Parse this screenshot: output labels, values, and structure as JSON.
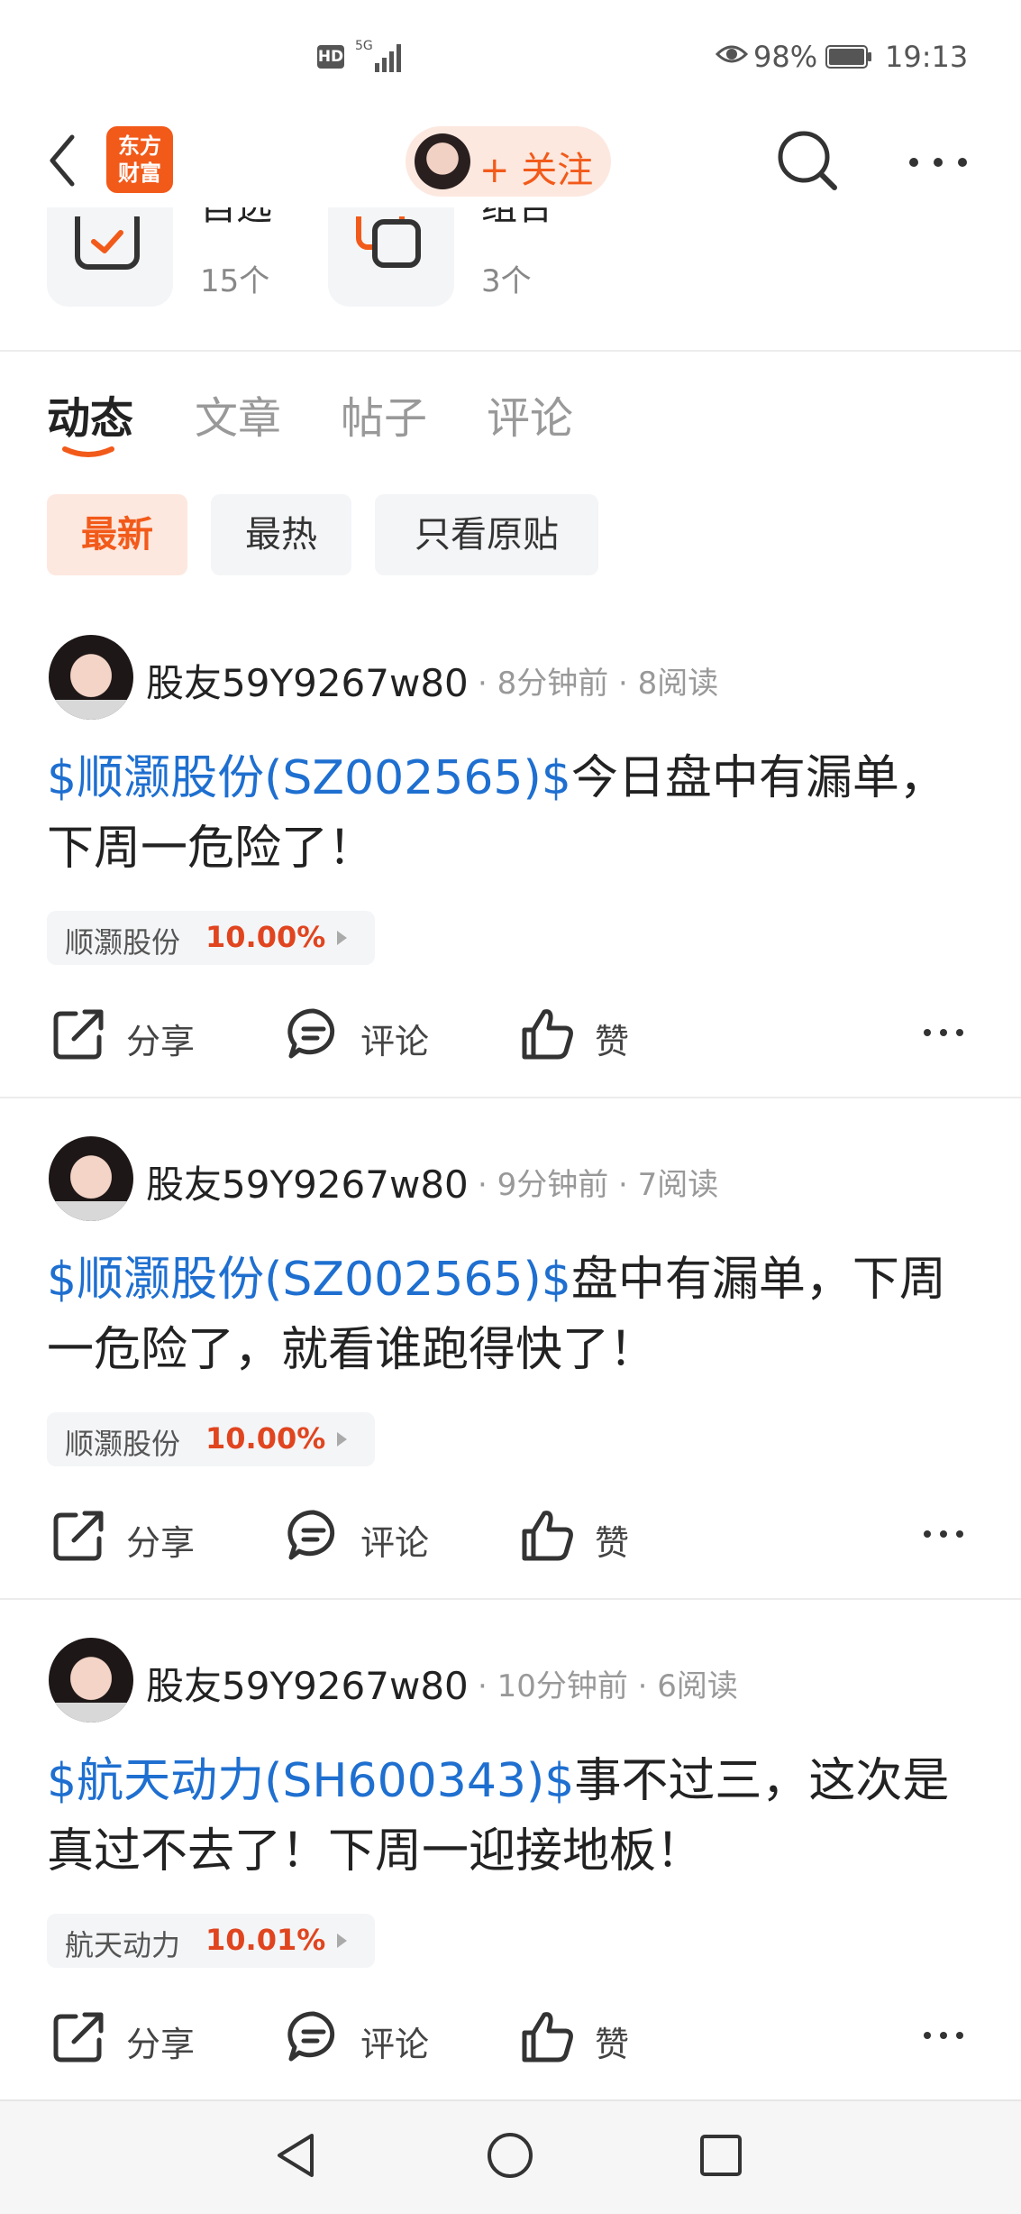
{
  "status_bar": {
    "hd": "HD",
    "network": "5G",
    "battery_pct": "98%",
    "time": "19:13"
  },
  "header": {
    "logo": "东方财富",
    "follow_label": "+ 关注"
  },
  "profile_stats": [
    {
      "title": "自选",
      "count": "15个"
    },
    {
      "title": "组合",
      "count": "3个"
    }
  ],
  "tabs": [
    {
      "label": "动态",
      "active": true
    },
    {
      "label": "文章",
      "active": false
    },
    {
      "label": "帖子",
      "active": false
    },
    {
      "label": "评论",
      "active": false
    }
  ],
  "filters": [
    {
      "label": "最新",
      "active": true
    },
    {
      "label": "最热",
      "active": false
    },
    {
      "label": "只看原贴",
      "active": false
    }
  ],
  "actions": {
    "share": "分享",
    "comment": "评论",
    "like": "赞"
  },
  "posts": [
    {
      "author": "股友59Y9267w80",
      "meta": "· 8分钟前 · 8阅读",
      "ticker": "$顺灏股份(SZ002565)$",
      "text": "今日盘中有漏单，下周一危险了！",
      "stock_name": "顺灏股份",
      "stock_pct": "10.00%"
    },
    {
      "author": "股友59Y9267w80",
      "meta": "· 9分钟前 · 7阅读",
      "ticker": "$顺灏股份(SZ002565)$",
      "text": "盘中有漏单，下周一危险了，就看谁跑得快了！",
      "stock_name": "顺灏股份",
      "stock_pct": "10.00%"
    },
    {
      "author": "股友59Y9267w80",
      "meta": "· 10分钟前 · 6阅读",
      "ticker": "$航天动力(SH600343)$",
      "text": "事不过三，这次是真过不去了！下周一迎接地板！",
      "stock_name": "航天动力",
      "stock_pct": "10.01%"
    }
  ],
  "colors": {
    "accent": "#f25a1a",
    "ticker_blue": "#1e6fd0",
    "rise_red": "#e0451f"
  }
}
